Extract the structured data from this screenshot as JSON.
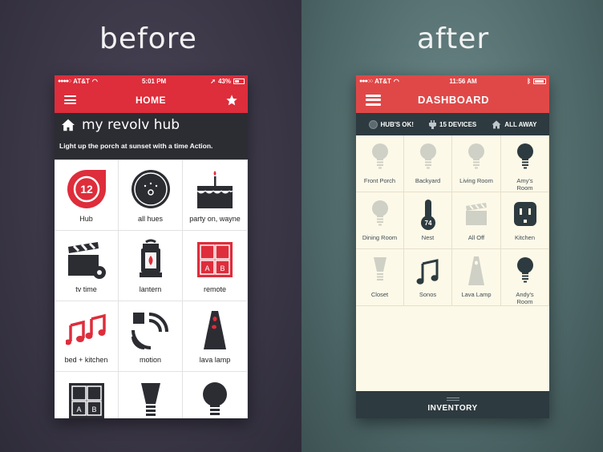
{
  "labels": {
    "before": "before",
    "after": "after"
  },
  "colors": {
    "before_red": "#de2d3b",
    "after_red": "#e04848",
    "dark": "#2c2d33",
    "teal_dark": "#2d3a3f",
    "cream": "#fdf9e8"
  },
  "before": {
    "status": {
      "carrier": "AT&T",
      "time": "5:01 PM",
      "battery": "43%"
    },
    "nav_title": "HOME",
    "hub_title": "my revolv hub",
    "tip": "Light up the porch at sunset with a time Action.",
    "hub_badge": "12",
    "items": [
      {
        "label": "Hub",
        "icon": "hub-badge-icon"
      },
      {
        "label": "all hues",
        "icon": "hue-bridge-icon"
      },
      {
        "label": "party on, wayne",
        "icon": "cake-icon"
      },
      {
        "label": "tv time",
        "icon": "clapperboard-gear-icon"
      },
      {
        "label": "lantern",
        "icon": "lantern-icon"
      },
      {
        "label": "remote",
        "icon": "remote-icon"
      },
      {
        "label": "bed + kitchen",
        "icon": "music-notes-icon"
      },
      {
        "label": "motion",
        "icon": "motion-icon"
      },
      {
        "label": "lava lamp",
        "icon": "lava-lamp-icon"
      },
      {
        "label": "",
        "icon": "remote-icon"
      },
      {
        "label": "",
        "icon": "led-bulb-icon"
      },
      {
        "label": "",
        "icon": "bulb-icon"
      }
    ],
    "remote_letters": [
      "A",
      "B"
    ]
  },
  "after": {
    "status": {
      "carrier": "AT&T",
      "time": "11:56 AM"
    },
    "nav_title": "DASHBOARD",
    "toolbar": {
      "hub_status": "HUB'S OK!",
      "devices": "15 DEVICES",
      "away": "ALL AWAY"
    },
    "nest_temp": "74",
    "items": [
      {
        "label": "Front Porch",
        "icon": "bulb-icon",
        "on": false
      },
      {
        "label": "Backyard",
        "icon": "bulb-icon",
        "on": false
      },
      {
        "label": "Living Room",
        "icon": "bulb-icon",
        "on": false
      },
      {
        "label": "Amy's\nRoom",
        "icon": "bulb-icon",
        "on": true
      },
      {
        "label": "Dining Room",
        "icon": "bulb-icon",
        "on": false
      },
      {
        "label": "Nest",
        "icon": "thermometer-icon",
        "on": true
      },
      {
        "label": "All Off",
        "icon": "clapperboard-icon",
        "on": false
      },
      {
        "label": "Kitchen",
        "icon": "outlet-icon",
        "on": true
      },
      {
        "label": "Closet",
        "icon": "led-bulb-icon",
        "on": false
      },
      {
        "label": "Sonos",
        "icon": "music-note-icon",
        "on": true
      },
      {
        "label": "Lava Lamp",
        "icon": "lava-lamp-icon",
        "on": false
      },
      {
        "label": "Andy's\nRoom",
        "icon": "bulb-icon",
        "on": true
      }
    ],
    "inventory": "INVENTORY"
  }
}
